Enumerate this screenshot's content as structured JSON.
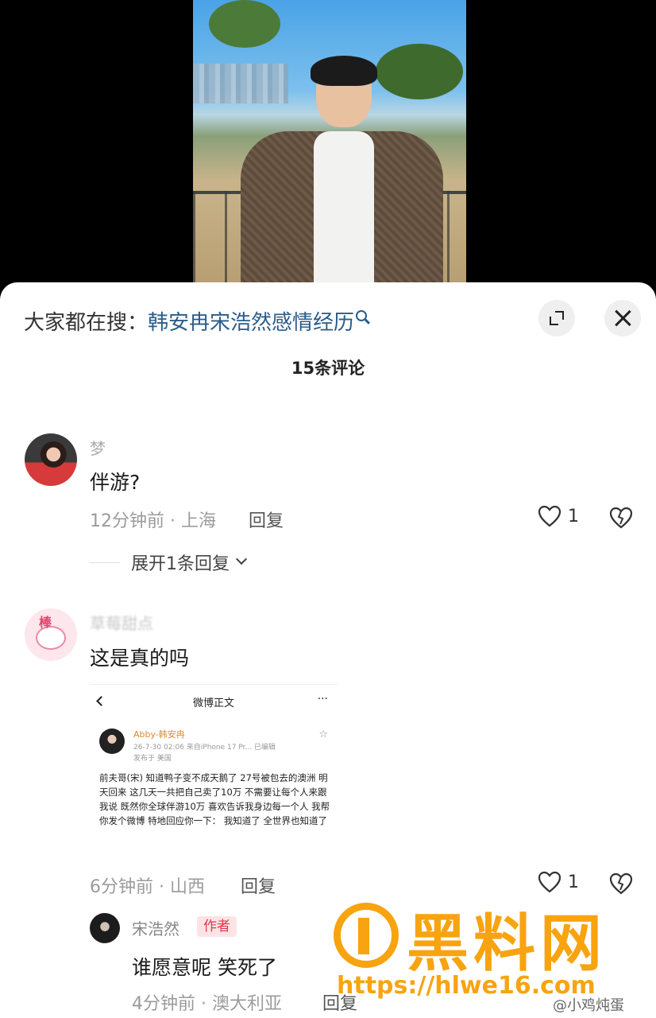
{
  "search": {
    "prefix": "大家都在搜：",
    "query": "韩安冉宋浩然感情经历"
  },
  "comment_count": "15条评论",
  "comments": [
    {
      "username": "梦",
      "text": "伴游?",
      "time_location": "12分钟前 · 上海",
      "reply_label": "回复",
      "likes": "1",
      "expand_replies": "展开1条回复"
    },
    {
      "username": "草莓甜点",
      "text": "这是真的吗",
      "time_location": "6分钟前 · 山西",
      "reply_label": "回复",
      "likes": "1",
      "embedded_post": {
        "nav_title": "微博正文",
        "more": "···",
        "author": "Abby-韩安冉",
        "sub": "26-7-30 02:06  来自iPhone 17 Pr...  已编辑",
        "location": "发布于 美国",
        "body": "前夫哥(宋) 知道鸭子变不成天鹅了 27号被包去的澳洲 明天回来 这几天一共把自己卖了10万 不需要让每个人来跟我说 既然你全球伴游10万 喜欢告诉我身边每一个人 我帮你发个微博 特地回应你一下： 我知道了 全世界也知道了"
      }
    }
  ],
  "author_reply": {
    "username": "宋浩然",
    "badge": "作者",
    "text": "谁愿意呢 笑死了",
    "time_location": "4分钟前 · 澳大利亚",
    "reply_label": "回复"
  },
  "watermark": {
    "title": "黑料网",
    "url": "https://hlwe16.com",
    "weibo": "@小鸡炖蛋"
  },
  "colors": {
    "search_query": "#2b5c8a",
    "author_badge": "#e8344a",
    "watermark": "#f7a410"
  }
}
